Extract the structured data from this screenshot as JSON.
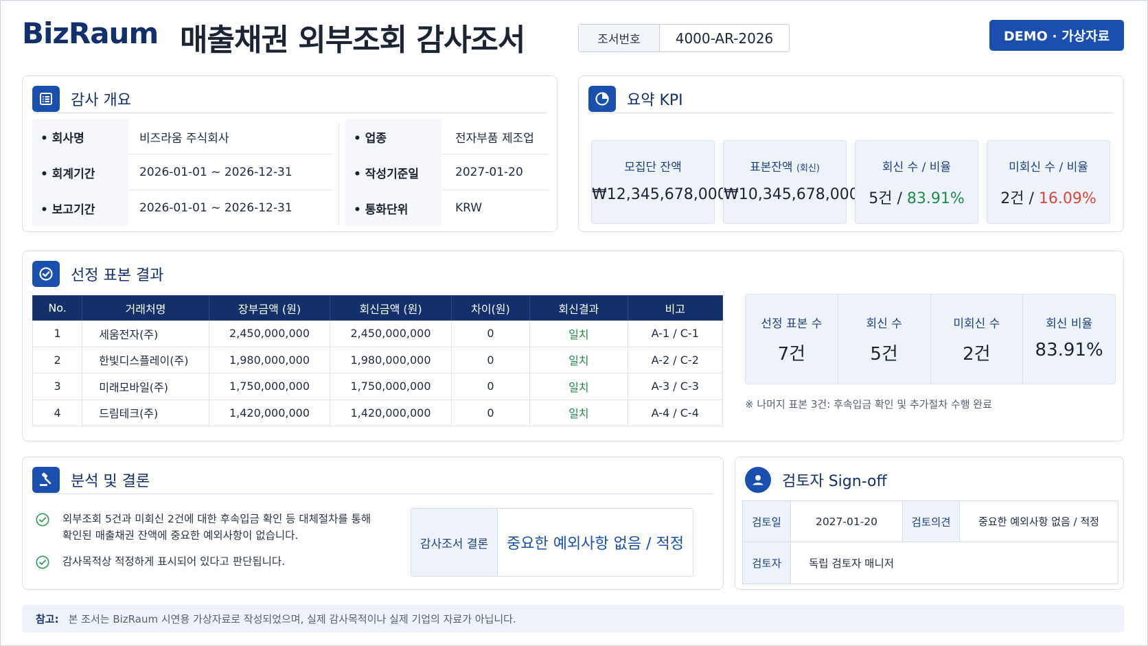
{
  "header": {
    "brand": "BizRaum",
    "title": "매출채권 외부조회 감사조서",
    "docno_label": "조서번호",
    "docno_value": "4000-AR-2026",
    "badge": "DEMO · 가상자료"
  },
  "overview": {
    "title": "감사 개요",
    "icon": "list-icon",
    "rows": [
      {
        "l1": "• 회사명",
        "v1": "비즈라움 주식회사",
        "l2": "• 업종",
        "v2": "전자부품 제조업"
      },
      {
        "l1": "• 회계기간",
        "v1": "2026-01-01 ~ 2026-12-31",
        "l2": "• 작성기준일",
        "v2": "2027-01-20"
      },
      {
        "l1": "• 보고기간",
        "v1": "2026-01-01 ~ 2026-12-31",
        "l2": "• 통화단위",
        "v2": "KRW"
      }
    ]
  },
  "kpi": {
    "title": "요약 KPI",
    "icon": "pie-chart-icon",
    "cards": [
      {
        "label": "모집단 잔액",
        "value": "₩12,345,678,000"
      },
      {
        "label": "표본잔액",
        "label_small": "(회신)",
        "value": "₩10,345,678,000"
      },
      {
        "label": "회신 수 / 비율",
        "count": "5건",
        "sep": " / ",
        "ratio": "83.91%"
      },
      {
        "label": "미회신 수 / 비율",
        "count": "2건",
        "sep": " / ",
        "ratio": "16.09%"
      }
    ]
  },
  "samples": {
    "title": "선정 표본 결과",
    "icon": "check-badge-icon",
    "columns": [
      "No.",
      "거래처명",
      "장부금액 (원)",
      "회신금액 (원)",
      "차이(원)",
      "회신결과",
      "비고"
    ],
    "rows": [
      [
        "1",
        "세움전자(주)",
        "2,450,000,000",
        "2,450,000,000",
        "0",
        "일치",
        "A-1 / C-1"
      ],
      [
        "2",
        "한빛디스플레이(주)",
        "1,980,000,000",
        "1,980,000,000",
        "0",
        "일치",
        "A-2 / C-2"
      ],
      [
        "3",
        "미래모바일(주)",
        "1,750,000,000",
        "1,750,000,000",
        "0",
        "일치",
        "A-3 / C-3"
      ],
      [
        "4",
        "드림테크(주)",
        "1,420,000,000",
        "1,420,000,000",
        "0",
        "일치",
        "A-4 / C-4"
      ]
    ],
    "summary": [
      {
        "label": "선정 표본 수",
        "value": "7건"
      },
      {
        "label": "회신 수",
        "value": "5건"
      },
      {
        "label": "미회신 수",
        "value": "2건"
      },
      {
        "label": "회신 비율",
        "value": "83.91%"
      }
    ],
    "note": "※ 나머지 표본 3건: 후속입금 확인 및 추가절차 수행 완료"
  },
  "analysis": {
    "title": "분석 및 결론",
    "icon": "gavel-icon",
    "items": [
      "외부조회 5건과 미회신 2건에 대한 후속입금 확인 등 대체절차를 통해\n확인된 매출채권 잔액에 중요한 예외사항이 없습니다.",
      "감사목적상 적정하게 표시되어 있다고 판단됩니다."
    ],
    "conclusion_label": "감사조서 결론",
    "conclusion_value": "중요한 예외사항 없음 / 적정"
  },
  "signoff": {
    "title": "검토자 Sign-off",
    "icon": "user-icon",
    "date_label": "검토일",
    "date_value": "2027-01-20",
    "opinion_label": "검토의견",
    "opinion_value": "중요한 예외사항 없음 / 적정",
    "reviewer_label": "검토자",
    "reviewer_value": "독립 검토자 매니저"
  },
  "footnote": {
    "label": "참고:",
    "text": "본 조서는 BizRaum 시연용 가상자료로 작성되었으며, 실제 감사목적이나 실제 기업의 자료가 아닙니다."
  },
  "colors": {
    "brand": "#14306b",
    "accent": "#1a4fb0",
    "positive": "#1f8a4c",
    "negative": "#e0453a"
  }
}
